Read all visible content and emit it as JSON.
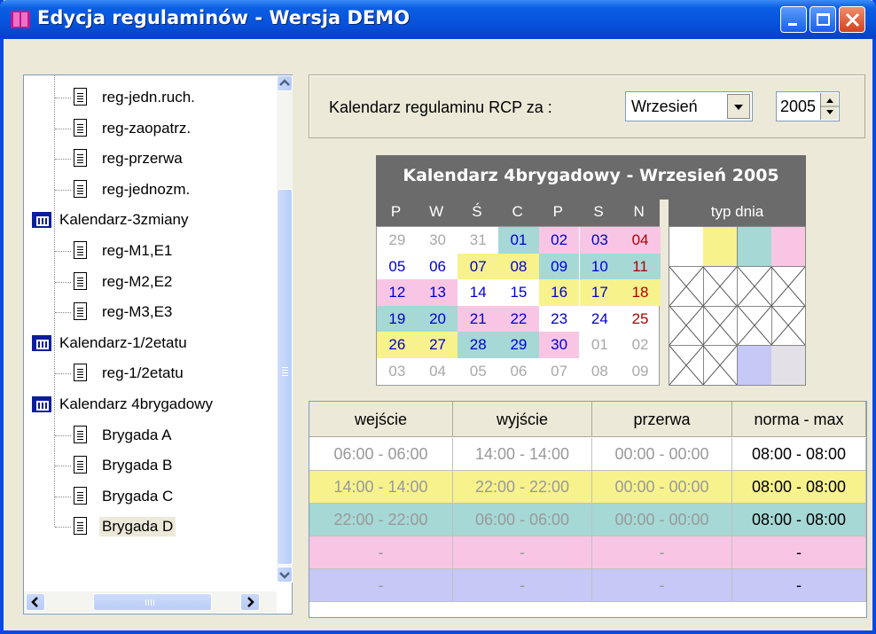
{
  "window": {
    "title": "Edycja regulaminów - Wersja DEMO"
  },
  "tree": {
    "items": [
      {
        "label": "reg-jedn.ruch.",
        "type": "doc",
        "level": 1
      },
      {
        "label": "reg-zaopatrz.",
        "type": "doc",
        "level": 1
      },
      {
        "label": "reg-przerwa",
        "type": "doc",
        "level": 1
      },
      {
        "label": "reg-jednozm.",
        "type": "doc",
        "level": 1
      },
      {
        "label": "Kalendarz-3zmiany",
        "type": "calendar",
        "level": 0
      },
      {
        "label": "reg-M1,E1",
        "type": "doc",
        "level": 1
      },
      {
        "label": "reg-M2,E2",
        "type": "doc",
        "level": 1
      },
      {
        "label": "reg-M3,E3",
        "type": "doc",
        "level": 1
      },
      {
        "label": "Kalendarz-1/2etatu",
        "type": "calendar",
        "level": 0
      },
      {
        "label": "reg-1/2etatu",
        "type": "doc",
        "level": 1
      },
      {
        "label": "Kalendarz 4brygadowy",
        "type": "calendar",
        "level": 0
      },
      {
        "label": "Brygada A",
        "type": "doc",
        "level": 1
      },
      {
        "label": "Brygada B",
        "type": "doc",
        "level": 1
      },
      {
        "label": "Brygada C",
        "type": "doc",
        "level": 1
      },
      {
        "label": "Brygada D",
        "type": "doc",
        "level": 1,
        "selected": true
      }
    ]
  },
  "selector": {
    "label": "Kalendarz regulaminu RCP  za :",
    "month": "Wrzesień",
    "year": "2005"
  },
  "calendar": {
    "title": "Kalendarz 4brygadowy - Wrzesień 2005",
    "day_names": [
      "P",
      "W",
      "Ś",
      "C",
      "P",
      "S",
      "N"
    ],
    "typ_dnia_label": "typ dnia",
    "weeks": [
      [
        [
          "29",
          "out",
          ""
        ],
        [
          "30",
          "out",
          ""
        ],
        [
          "31",
          "out",
          ""
        ],
        [
          "01",
          "blue",
          "teal"
        ],
        [
          "02",
          "blue",
          "pink"
        ],
        [
          "03",
          "blue",
          "pink"
        ],
        [
          "04",
          "red",
          "pink"
        ]
      ],
      [
        [
          "05",
          "blue",
          ""
        ],
        [
          "06",
          "blue",
          ""
        ],
        [
          "07",
          "blue",
          "yellow"
        ],
        [
          "08",
          "blue",
          "yellow"
        ],
        [
          "09",
          "blue",
          "teal"
        ],
        [
          "10",
          "blue",
          "teal"
        ],
        [
          "11",
          "red",
          "teal"
        ]
      ],
      [
        [
          "12",
          "blue",
          "pink"
        ],
        [
          "13",
          "blue",
          "pink"
        ],
        [
          "14",
          "blue",
          ""
        ],
        [
          "15",
          "blue",
          ""
        ],
        [
          "16",
          "blue",
          "yellow"
        ],
        [
          "17",
          "blue",
          "yellow"
        ],
        [
          "18",
          "red",
          "yellow"
        ]
      ],
      [
        [
          "19",
          "blue",
          "teal"
        ],
        [
          "20",
          "blue",
          "teal"
        ],
        [
          "21",
          "blue",
          "pink"
        ],
        [
          "22",
          "blue",
          "pink"
        ],
        [
          "23",
          "blue",
          ""
        ],
        [
          "24",
          "blue",
          ""
        ],
        [
          "25",
          "red",
          ""
        ]
      ],
      [
        [
          "26",
          "blue",
          "yellow"
        ],
        [
          "27",
          "blue",
          "yellow"
        ],
        [
          "28",
          "blue",
          "teal"
        ],
        [
          "29",
          "blue",
          "teal"
        ],
        [
          "30",
          "blue",
          "pink"
        ],
        [
          "01",
          "out",
          ""
        ],
        [
          "02",
          "out",
          ""
        ]
      ],
      [
        [
          "03",
          "out",
          ""
        ],
        [
          "04",
          "out",
          ""
        ],
        [
          "05",
          "out",
          ""
        ],
        [
          "06",
          "out",
          ""
        ],
        [
          "07",
          "out",
          ""
        ],
        [
          "08",
          "out",
          ""
        ],
        [
          "09",
          "out",
          ""
        ]
      ]
    ],
    "types": [
      [
        "white",
        "yellow",
        "teal",
        "pink"
      ],
      [
        "x",
        "x",
        "x",
        "x"
      ],
      [
        "x",
        "x",
        "x",
        "x"
      ],
      [
        "x",
        "x",
        "lavender",
        "lightgray"
      ]
    ]
  },
  "colors": {
    "yellow": "#f7f28c",
    "teal": "#a6d8d6",
    "pink": "#f8c6e4",
    "lavender": "#c6c8f6",
    "lightgray": "#e4e0e8",
    "white": "#ffffff",
    "blue": "#0000cc",
    "red": "#b00000",
    "out": "#a8a8a8"
  },
  "shifts": {
    "headers": [
      "wejście",
      "wyjście",
      "przerwa",
      "norma - max"
    ],
    "rows": [
      {
        "color": "white",
        "cells": [
          "06:00 - 06:00",
          "14:00 - 14:00",
          "00:00 - 00:00",
          "08:00 - 08:00"
        ]
      },
      {
        "color": "yellow",
        "cells": [
          "14:00 - 14:00",
          "22:00 - 22:00",
          "00:00 - 00:00",
          "08:00 - 08:00"
        ]
      },
      {
        "color": "teal",
        "cells": [
          "22:00 - 22:00",
          "06:00 - 06:00",
          "00:00 - 00:00",
          "08:00 - 08:00"
        ]
      },
      {
        "color": "pink",
        "cells": [
          "-",
          "-",
          "-",
          "-"
        ]
      },
      {
        "color": "lavender",
        "cells": [
          "-",
          "-",
          "-",
          "-"
        ]
      }
    ]
  }
}
